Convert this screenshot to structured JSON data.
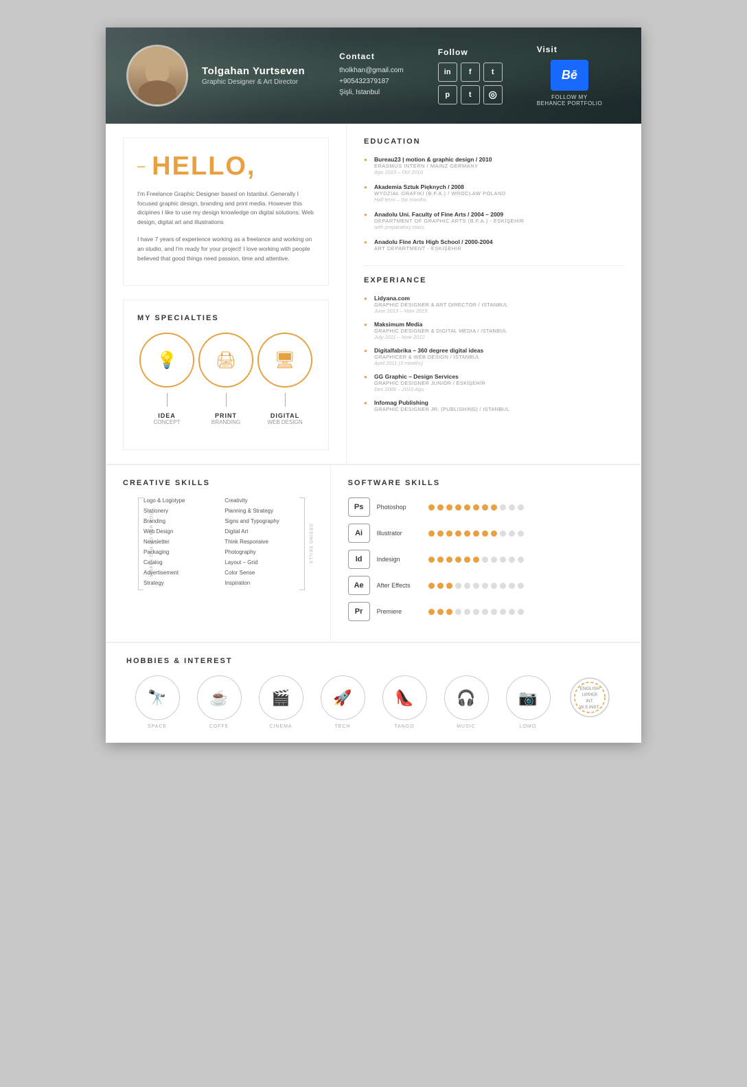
{
  "header": {
    "name": "Tolgahan Yurtseven",
    "title": "Graphic Designer & Art Director",
    "contact_label": "Contact",
    "email": "tholkhan@gmail.com",
    "phone": "+905432379187",
    "location": "Şişli, Istanbul",
    "follow_label": "Follow",
    "visit_label": "Visit",
    "behance_text": "FOLLOW MY\nBEHANCE PORTFOLIO",
    "social": [
      "in",
      "f",
      "t",
      "p",
      "t",
      "☞"
    ]
  },
  "hello": {
    "greeting": "HELLO,",
    "dash": "–",
    "para1": "I'm Freelance Graphic Designer based on Istanbul. Generally I focused graphic design, branding and print media. However this dicipines I like to use my design knowledge on digital solutions. Web design, digital art and illustrations",
    "para2": "I have 7 years of experience working as a freelance and working on an studio, and I'm ready for your project! I love working with people believed that good things need passion, time and attentive."
  },
  "specialties": {
    "title": "MY SPECIALTIES",
    "items": [
      {
        "label": "IDEA",
        "sublabel": "CONCEPT"
      },
      {
        "label": "PRINT",
        "sublabel": "BRANDING"
      },
      {
        "label": "DIGITAL",
        "sublabel": "WEB DESIGN"
      }
    ]
  },
  "education": {
    "title": "EDUCATION",
    "items": [
      {
        "name": "Bureau23 | motion & graphic design / 2010",
        "sub": "ERASMUS INTERN / MAINZ GERMANY",
        "date": "Agu 2010 – Oct 2010"
      },
      {
        "name": "Akademia Sztuk Pięknych / 2008",
        "sub": "WYDZIAŁ GRAFIKI (B.F.A.) / WROCLAW POLAND",
        "date": "Half term – Six months"
      },
      {
        "name": "Anadolu Uni. Faculty of Fine Arts / 2004 – 2009",
        "sub": "DEPARTMENT OF GRAPHIC ARTS (B.F.A.) - ESKİŞEHİR",
        "date": "with preparatory class"
      },
      {
        "name": "Anadolu Fine Arts High School / 2000-2004",
        "sub": "ART DEPARTMENT - ESKİŞEHİR",
        "date": ""
      }
    ]
  },
  "experience": {
    "title": "EXPERIANCE",
    "items": [
      {
        "company": "Lidyana.com",
        "role": "GRAPHIC DESIGNER & ART DIRECTOR / ISTANBUL",
        "date": "June 2013 – Now 2015"
      },
      {
        "company": "Maksimum Media",
        "role": "GRAPHIC DESIGNER & DIGITAL MEDIA / ISTANBUL",
        "date": "July 2011 – Now 2012"
      },
      {
        "company": "Digitalfabrika – 360 degree digital ideas",
        "role": "GRAPHICER & WEB DESIGN / ISTANBUL",
        "date": "April 2011 (3 months)"
      },
      {
        "company": "GG Graphic – Design Services",
        "role": "GRAPHIC DESIGNER JUNIOR / ESKİŞEHİR",
        "date": "Dec 2009 – 2010 Agu"
      },
      {
        "company": "Infomag Publishing",
        "role": "GRAPHIC DESIGNER JR. (PUBLISHING) / ISTANBUL",
        "date": ""
      }
    ]
  },
  "creative_skills": {
    "title": "CREATIVE SKILLS",
    "left_label": "WHAT I CAN DO FOR YOU",
    "right_label": "DESING SKILLS",
    "col1": [
      "Logo & Logotype",
      "Stationery",
      "Branding",
      "Web Design",
      "Newsletter",
      "Packaging",
      "Catalog",
      "Advertisement",
      "Strategy"
    ],
    "col2": [
      "Creativity",
      "Planning & Strategy",
      "Signs and Typography",
      "Digital Art",
      "Think Responsive",
      "Photography",
      "Layout – Grid",
      "Color Sense",
      "Inspiration"
    ]
  },
  "software_skills": {
    "title": "SOFTWARE SKILLS",
    "items": [
      {
        "name": "Photoshop",
        "abbr": "Ps",
        "filled": 8,
        "empty": 3
      },
      {
        "name": "Illustrator",
        "abbr": "Ai",
        "filled": 8,
        "empty": 3
      },
      {
        "name": "Indesign",
        "abbr": "Id",
        "filled": 6,
        "empty": 5
      },
      {
        "name": "After Effects",
        "abbr": "Ae",
        "filled": 3,
        "empty": 8
      },
      {
        "name": "Premiere",
        "abbr": "Pr",
        "filled": 3,
        "empty": 8
      }
    ]
  },
  "hobbies": {
    "title": "HOBBIES & INTEREST",
    "items": [
      {
        "label": "SPACE",
        "icon": "🔭"
      },
      {
        "label": "COFFE",
        "icon": "☕"
      },
      {
        "label": "CINEMA",
        "icon": "🎬"
      },
      {
        "label": "TECH",
        "icon": "🚀"
      },
      {
        "label": "TANGO",
        "icon": "👠"
      },
      {
        "label": "MUSIC",
        "icon": "🎧"
      },
      {
        "label": "LOMO",
        "icon": "📷"
      }
    ],
    "language": {
      "label": "ENGLISH\nUPPER INT.\nW.S.INST."
    }
  }
}
